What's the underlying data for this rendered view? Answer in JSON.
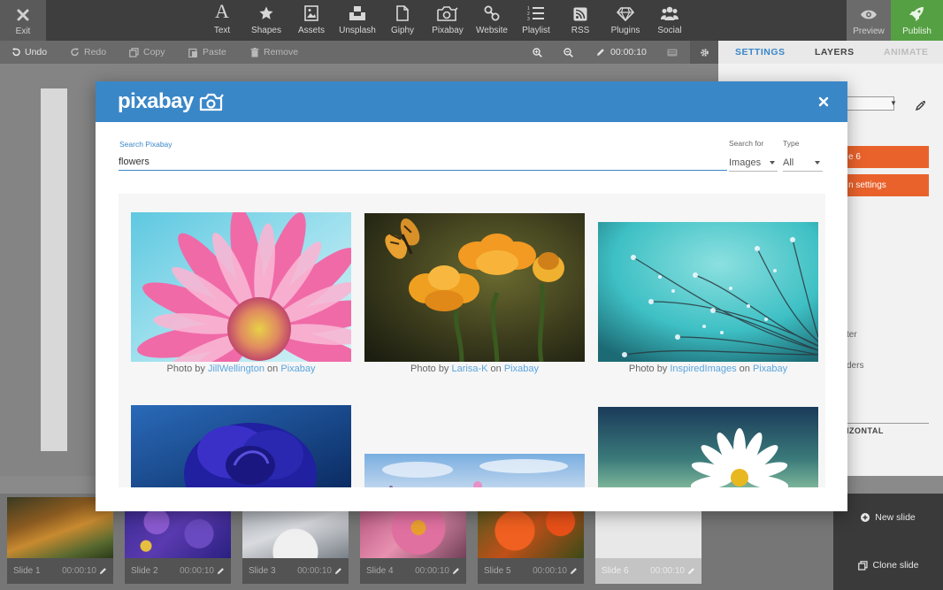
{
  "toolbar": {
    "exit": "Exit",
    "items": [
      {
        "label": "Text",
        "icon": "text-icon"
      },
      {
        "label": "Shapes",
        "icon": "star-icon"
      },
      {
        "label": "Assets",
        "icon": "image-icon"
      },
      {
        "label": "Unsplash",
        "icon": "unsplash-icon"
      },
      {
        "label": "Giphy",
        "icon": "file-icon"
      },
      {
        "label": "Pixabay",
        "icon": "camera-icon"
      },
      {
        "label": "Website",
        "icon": "link-icon"
      },
      {
        "label": "Playlist",
        "icon": "list-icon"
      },
      {
        "label": "RSS",
        "icon": "rss-icon"
      },
      {
        "label": "Plugins",
        "icon": "diamond-icon"
      },
      {
        "label": "Social",
        "icon": "users-icon"
      }
    ],
    "preview": "Preview",
    "publish": "Publish"
  },
  "actions": {
    "undo": "Undo",
    "redo": "Redo",
    "copy": "Copy",
    "paste": "Paste",
    "remove": "Remove",
    "duration": "00:00:10"
  },
  "right_panel": {
    "tabs": [
      "SETTINGS",
      "LAYERS",
      "ANIMATE"
    ],
    "button_1": "e 6",
    "button_2": "n settings",
    "text_1": "ter",
    "text_2": "ders",
    "text_3": "IZONTAL"
  },
  "modal": {
    "brand": "pixabay",
    "close": "×",
    "search_label": "Search Pixabay",
    "search_value": "flowers",
    "search_for_label": "Search for",
    "search_for_value": "Images",
    "type_label": "Type",
    "type_value": "All",
    "credit_prefix": "Photo by",
    "credit_on": "on",
    "credit_site": "Pixabay",
    "photos": [
      {
        "author": "JillWellington",
        "subject": "pink daisy"
      },
      {
        "author": "Larisa-K",
        "subject": "orange flowers with butterfly"
      },
      {
        "author": "InspiredImages",
        "subject": "dandelion with dew drops"
      },
      {
        "author": "",
        "subject": "blue rose"
      },
      {
        "author": "",
        "subject": "sky with flowers"
      },
      {
        "author": "",
        "subject": "white daisy"
      }
    ]
  },
  "slides": [
    {
      "label": "Slide 1",
      "duration": "00:00:10"
    },
    {
      "label": "Slide 2",
      "duration": "00:00:10"
    },
    {
      "label": "Slide 3",
      "duration": "00:00:10"
    },
    {
      "label": "Slide 4",
      "duration": "00:00:10"
    },
    {
      "label": "Slide 5",
      "duration": "00:00:10"
    },
    {
      "label": "Slide 6",
      "duration": "00:00:10"
    }
  ],
  "slide_actions": {
    "new_slide": "New slide",
    "clone_slide": "Clone slide"
  },
  "colors": {
    "accent": "#3a87c8",
    "publish": "#55a043",
    "orange": "#e9622c",
    "link": "#5aa5de"
  }
}
